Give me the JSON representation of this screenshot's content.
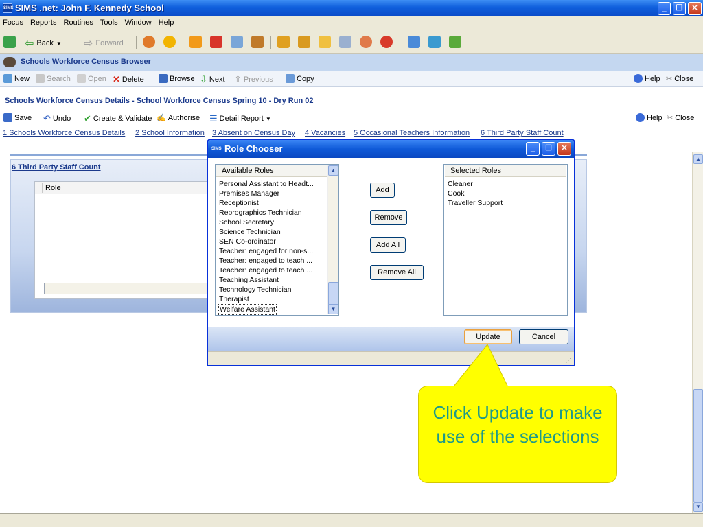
{
  "window": {
    "logo": "SIMS",
    "title": "SIMS .net: John F. Kennedy School",
    "controls": [
      "minimize-icon",
      "restore-icon",
      "close-icon"
    ]
  },
  "menu": [
    "Focus",
    "Reports",
    "Routines",
    "Tools",
    "Window",
    "Help"
  ],
  "nav": {
    "back": "Back",
    "forward": "Forward"
  },
  "browser": {
    "title": "Schools Workforce Census Browser",
    "toolbar": {
      "new": "New",
      "search": "Search",
      "open": "Open",
      "delete": "Delete",
      "browse": "Browse",
      "next": "Next",
      "previous": "Previous",
      "copy": "Copy",
      "help": "Help",
      "close": "Close"
    }
  },
  "details": {
    "title": "Schools Workforce Census Details - School Workforce Census Spring 10 - Dry Run 02",
    "toolbar": {
      "save": "Save",
      "undo": "Undo",
      "create_validate": "Create & Validate",
      "authorise": "Authorise",
      "detail_report": "Detail Report",
      "help": "Help",
      "close": "Close"
    },
    "links": [
      "1 Schools Workforce Census Details",
      "2 School Information",
      "3 Absent on Census Day",
      "4 Vacancies",
      "5 Occasional Teachers Information",
      "6 Third Party Staff Count"
    ],
    "section_title": "6 Third Party Staff Count",
    "grid_header": "Role"
  },
  "dialog": {
    "logo": "SIMS",
    "title": "Role Chooser",
    "available_header": "Available Roles",
    "available_roles": [
      "Personal Assistant to Headt...",
      "Premises Manager",
      "Receptionist",
      "Reprographics Technician",
      "School Secretary",
      "Science Technician",
      "SEN Co-ordinator",
      "Teacher: engaged for non-s...",
      "Teacher: engaged to teach ...",
      "Teacher: engaged to teach ...",
      "Teaching Assistant",
      "Technology Technician",
      "Therapist",
      "Welfare Assistant"
    ],
    "selected_header": "Selected Roles",
    "selected_roles": [
      "Cleaner",
      "Cook",
      "Traveller Support"
    ],
    "buttons": {
      "add": "Add",
      "remove": "Remove",
      "add_all": "Add All",
      "remove_all": "Remove All",
      "update": "Update",
      "cancel": "Cancel"
    }
  },
  "callout": {
    "text": "Click Update to make use of the selections",
    "color": "#ffff00",
    "text_color": "#1f9a8a"
  }
}
